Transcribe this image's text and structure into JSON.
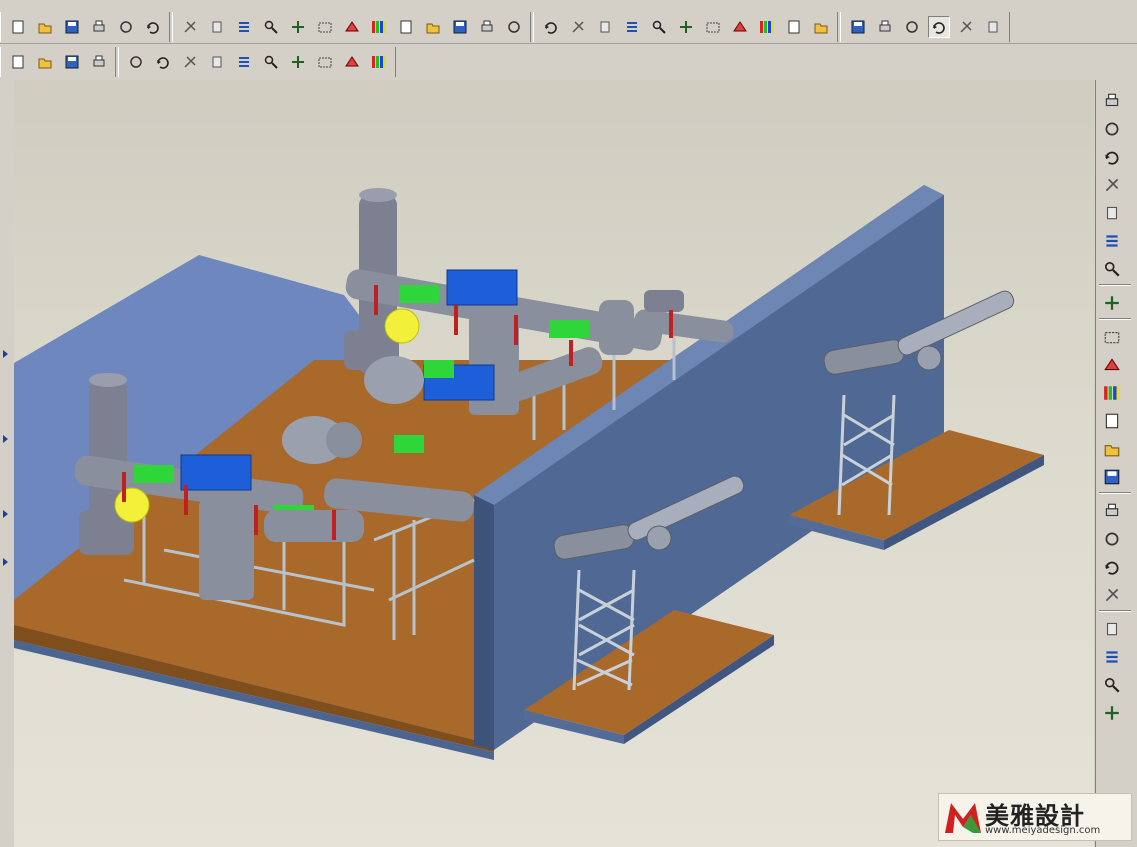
{
  "toolbar_main": {
    "groups": [
      [
        "new-icon",
        "open-icon",
        "save-icon",
        "print-icon",
        "print-preview-icon",
        "mail-icon"
      ],
      [
        "undo-icon",
        "redo-icon",
        "cut-icon",
        "copy-icon",
        "paste-icon",
        "paste-special-icon",
        "regenerate-icon",
        "regenerate-manager-icon",
        "find-icon",
        "select-box-icon",
        "dropdown-arrow-icon",
        "close-window-icon",
        "edit-icon"
      ],
      [
        "refit-icon",
        "spin-center-icon",
        "orient-icon",
        "pan-icon",
        "zoom-in-icon",
        "zoom-out-icon",
        "zoom-window-icon",
        "view-manager-icon",
        "named-views-icon",
        "layers-icon",
        "model-tree-icon"
      ],
      [
        "wireframe-icon",
        "hidden-line-icon",
        "no-hidden-icon",
        "shading-icon",
        "color-icon",
        "appearance-icon"
      ]
    ]
  },
  "toolbar_datum": {
    "groups": [
      [
        "datum-plane-display-icon",
        "datum-axis-display-icon",
        "datum-point-display-icon",
        "coordinate-system-display-icon"
      ],
      [
        "dimension-icon",
        "reference-dimension-icon",
        "geometric-tolerance-icon",
        "surface-finish-icon",
        "note-icon",
        "feature-info-icon",
        "kit-icon",
        "color-wheel-icon",
        "model-analysis-icon",
        "context-help-icon"
      ]
    ]
  },
  "right_toolbar": {
    "items": [
      "datum-curve-sketch-icon",
      "datum-plane-icon",
      "datum-axis-icon",
      "datum-curve-icon",
      "datum-point-icon",
      "coordinate-system-icon",
      "analysis-feature-icon",
      "note-tool-icon",
      "extrude-icon",
      "revolve-icon",
      "sweep-icon",
      "blend-icon",
      "round-icon",
      "chamfer-icon",
      "hole-icon",
      "shell-icon",
      "rib-icon",
      "draft-icon",
      "mirror-icon",
      "pattern-icon",
      "merge-icon",
      "trim-icon"
    ]
  },
  "watermark": {
    "brand": "美雅設計",
    "url": "www.meiyadesign.com"
  },
  "colors": {
    "toolbar_bg": "#d4d0c8",
    "floor_brown": "#a9692a",
    "wall_blue": "#4f6894",
    "floor_blue": "#6e88bf",
    "pipe_gray": "#8a8f9e",
    "flange_green": "#2ed63a",
    "actuator_blue": "#1d5fd8",
    "valve_yellow": "#f3f03a",
    "steel_frame": "#b8c2cc"
  }
}
